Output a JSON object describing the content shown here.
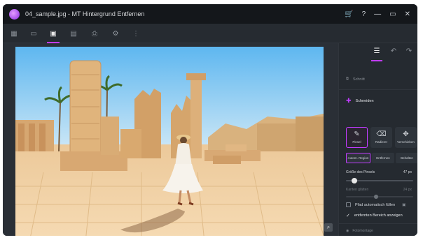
{
  "titlebar": {
    "title": "04_sample.jpg - MT Hintergrund Entfernen",
    "icons": [
      "cart-icon",
      "help-icon",
      "minimize-icon",
      "maximize-icon",
      "close-icon"
    ],
    "cart": "🛒",
    "help": "?",
    "minimize": "—",
    "maximize": "▭",
    "close": "✕"
  },
  "toolbar": {
    "tools": [
      {
        "name": "grid-icon",
        "glyph": "▦"
      },
      {
        "name": "folder-icon",
        "glyph": "▭"
      },
      {
        "name": "image-icon",
        "glyph": "▣",
        "active": true
      },
      {
        "name": "save-icon",
        "glyph": "▤"
      },
      {
        "name": "print-icon",
        "glyph": "⎙"
      },
      {
        "name": "settings-icon",
        "glyph": "⚙"
      },
      {
        "name": "more-icon",
        "glyph": "⋮"
      }
    ]
  },
  "panel": {
    "tabs": [
      {
        "name": "adjust-icon",
        "glyph": "☰",
        "active": true
      },
      {
        "name": "undo-icon",
        "glyph": "↶"
      },
      {
        "name": "redo-icon",
        "glyph": "↷"
      }
    ],
    "section_label": "Schnitt",
    "section_active": "Schneiden",
    "tools": [
      {
        "label": "Pinsel",
        "glyph": "✎",
        "active": true
      },
      {
        "label": "Radierer",
        "glyph": "⌫"
      },
      {
        "label": "Verschieben",
        "glyph": "✥"
      }
    ],
    "modes": [
      {
        "label": "Autom. Region",
        "active": true
      },
      {
        "label": "Entfernen"
      },
      {
        "label": "Behalten"
      }
    ],
    "brush_size_label": "Größe des Pinsels",
    "brush_size_value": "47 px",
    "brush_size_level": 0.12,
    "smoothing_label": "Kanten glätten",
    "smoothing_value": "24 px",
    "smoothing_level": 0.45,
    "auto_fill_label": "Pfad automatisch füllen",
    "show_removed_label": "entfernten Bereich anzeigen",
    "footer_label": "Fotomontage",
    "accent": "#c13cff"
  }
}
